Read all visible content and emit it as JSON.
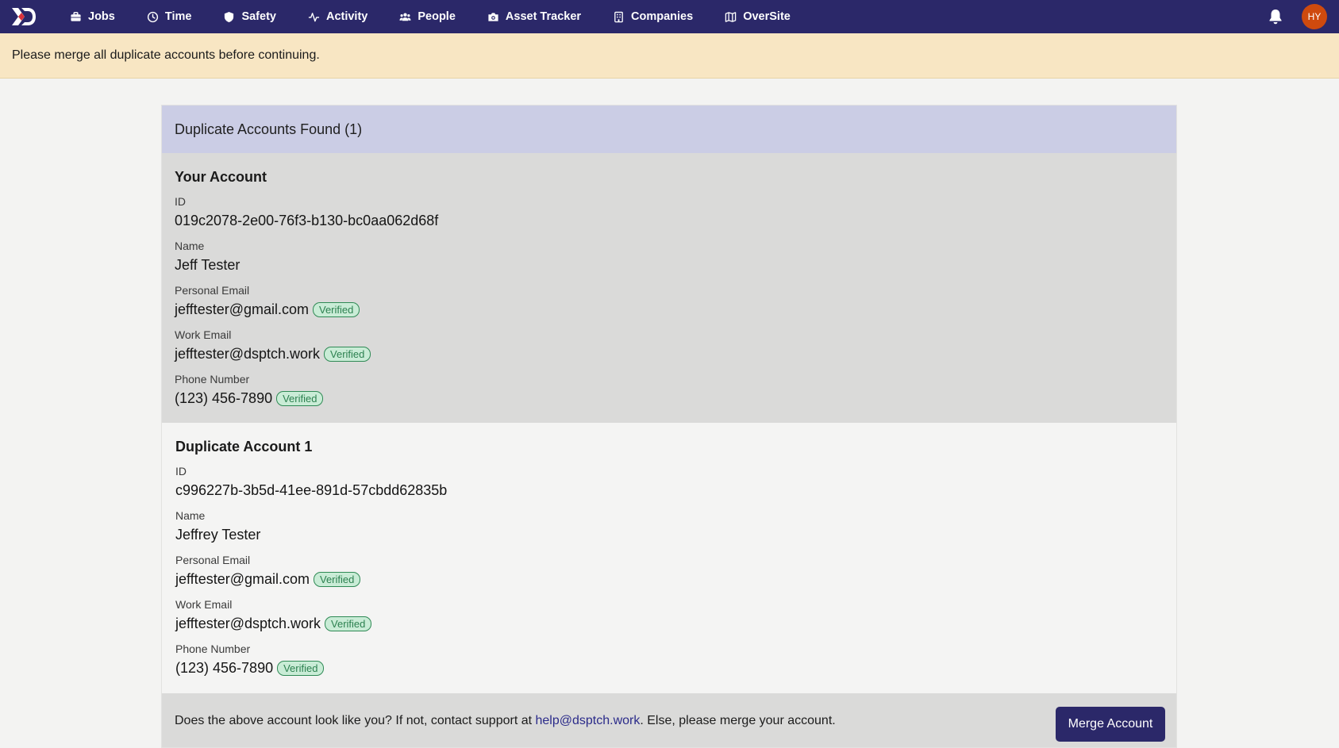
{
  "nav": {
    "items": [
      {
        "label": "Jobs",
        "icon": "briefcase-icon"
      },
      {
        "label": "Time",
        "icon": "clock-icon"
      },
      {
        "label": "Safety",
        "icon": "shield-icon"
      },
      {
        "label": "Activity",
        "icon": "activity-icon"
      },
      {
        "label": "People",
        "icon": "people-icon"
      },
      {
        "label": "Asset Tracker",
        "icon": "camera-icon"
      },
      {
        "label": "Companies",
        "icon": "building-icon"
      },
      {
        "label": "OverSite",
        "icon": "map-icon"
      }
    ],
    "avatar_initials": "HY"
  },
  "banner": {
    "message": "Please merge all duplicate accounts before continuing."
  },
  "card": {
    "title": "Duplicate Accounts Found (1)",
    "your_account": {
      "heading": "Your Account",
      "id_label": "ID",
      "id_value": "019c2078-2e00-76f3-b130-bc0aa062d68f",
      "name_label": "Name",
      "name_value": "Jeff Tester",
      "personal_email_label": "Personal Email",
      "personal_email_value": "jefftester@gmail.com",
      "personal_email_badge": "Verified",
      "work_email_label": "Work Email",
      "work_email_value": "jefftester@dsptch.work",
      "work_email_badge": "Verified",
      "phone_label": "Phone Number",
      "phone_value": "(123) 456-7890",
      "phone_badge": "Verified"
    },
    "duplicate_account": {
      "heading": "Duplicate Account 1",
      "id_label": "ID",
      "id_value": "c996227b-3b5d-41ee-891d-57cbdd62835b",
      "name_label": "Name",
      "name_value": "Jeffrey Tester",
      "personal_email_label": "Personal Email",
      "personal_email_value": "jefftester@gmail.com",
      "personal_email_badge": "Verified",
      "work_email_label": "Work Email",
      "work_email_value": "jefftester@dsptch.work",
      "work_email_badge": "Verified",
      "phone_label": "Phone Number",
      "phone_value": "(123) 456-7890",
      "phone_badge": "Verified"
    },
    "footer": {
      "text_before": "Does the above account look like you? If not, contact support at ",
      "support_link": "help@dsptch.work",
      "text_after": ". Else, please merge your account.",
      "merge_button": "Merge Account"
    }
  },
  "colors": {
    "nav_bg": "#2b2869",
    "banner_bg": "#f8e6c3",
    "card_header_bg": "#cbcde5",
    "badge_green": "#2f8a55",
    "avatar_bg": "#cf4a0e"
  }
}
